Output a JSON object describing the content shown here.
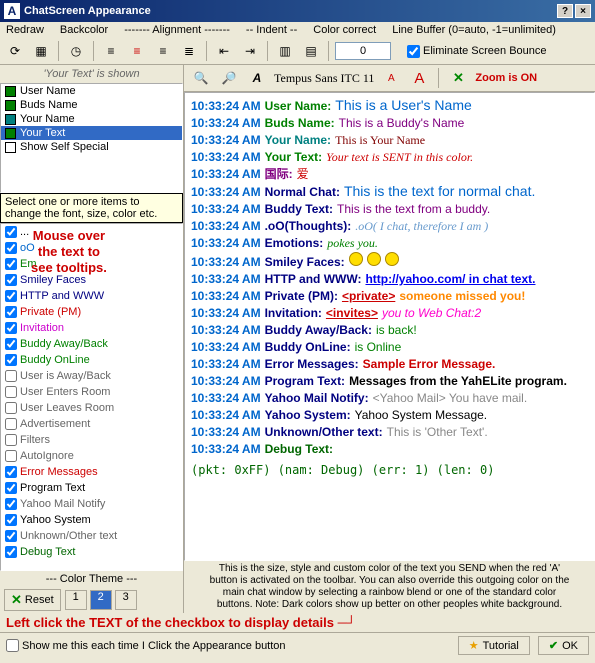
{
  "title": "ChatScreen Appearance",
  "menubar": {
    "redraw": "Redraw",
    "backcolor": "Backcolor",
    "alignment": "------- Alignment -------",
    "indent": "-- Indent --",
    "colorcorrect": "Color correct",
    "linebuf": "Line Buffer (0=auto, -1=unlimited)"
  },
  "linebuf_value": "0",
  "eliminate_bounce": "Eliminate Screen Bounce",
  "list_header": "'Your Text' is shown",
  "upper_list": [
    {
      "label": "User Name",
      "color": "#008000"
    },
    {
      "label": "Buds Name",
      "color": "#008000"
    },
    {
      "label": "Your Name",
      "color": "#008080"
    },
    {
      "label": "Your Text",
      "color": "#008000",
      "selected": true
    },
    {
      "label": "Show Self Special",
      "color": "#ffffff"
    }
  ],
  "tooltip": "Select one or more items to change the font, size, color etc.",
  "overlay": [
    "Mouse over",
    "the text to",
    "see tooltips."
  ],
  "check_list": [
    {
      "label": "...",
      "checked": true,
      "color": "#000"
    },
    {
      "label": "oO",
      "checked": true,
      "color": "#0066cc"
    },
    {
      "label": "Em",
      "checked": true,
      "color": "#008000"
    },
    {
      "label": "Smiley Faces",
      "checked": true,
      "color": "#000080"
    },
    {
      "label": "HTTP and WWW",
      "checked": true,
      "color": "#000080"
    },
    {
      "label": "Private (PM)",
      "checked": true,
      "color": "#cc0000"
    },
    {
      "label": "Invitation",
      "checked": true,
      "color": "#cc00cc"
    },
    {
      "label": "Buddy Away/Back",
      "checked": true,
      "color": "#008000"
    },
    {
      "label": "Buddy OnLine",
      "checked": true,
      "color": "#008000"
    },
    {
      "label": "User is Away/Back",
      "checked": false,
      "color": "#666"
    },
    {
      "label": "User Enters Room",
      "checked": false,
      "color": "#666"
    },
    {
      "label": "User Leaves Room",
      "checked": false,
      "color": "#666"
    },
    {
      "label": "Advertisement",
      "checked": false,
      "color": "#666"
    },
    {
      "label": "Filters",
      "checked": false,
      "color": "#666"
    },
    {
      "label": "AutoIgnore",
      "checked": false,
      "color": "#666"
    },
    {
      "label": "Error Messages",
      "checked": true,
      "color": "#cc0000"
    },
    {
      "label": "Program Text",
      "checked": true,
      "color": "#000"
    },
    {
      "label": "Yahoo Mail Notify",
      "checked": true,
      "color": "#666"
    },
    {
      "label": "Yahoo System",
      "checked": true,
      "color": "#000"
    },
    {
      "label": "Unknown/Other text",
      "checked": true,
      "color": "#666"
    },
    {
      "label": "Debug Text",
      "checked": true,
      "color": "#006600"
    }
  ],
  "font_tool": {
    "fontname": "Tempus Sans ITC 11",
    "zoom": "Zoom is ON"
  },
  "timestamp": "10:33:24 AM",
  "chat_lines": [
    {
      "label": "User Name:",
      "lcolor": "#008000",
      "text": "This is a User's Name",
      "tcolor": "#0066cc",
      "tsize": "14px"
    },
    {
      "label": "Buds Name:",
      "lcolor": "#008000",
      "text": "This is a Buddy's Name",
      "tcolor": "#800080"
    },
    {
      "label": "Your Name:",
      "lcolor": "#008080",
      "text": "This is Your Name",
      "tcolor": "#800000",
      "font": "cursive"
    },
    {
      "label": "Your Text:",
      "lcolor": "#008000",
      "text": "Your text is SENT in this color.",
      "tcolor": "#cc0000",
      "italic": true,
      "font": "cursive"
    },
    {
      "label": "国际:",
      "lcolor": "#800080",
      "text": "爱",
      "tcolor": "#cc0000"
    },
    {
      "label": "Normal Chat:",
      "lcolor": "#000080",
      "text": "This is the text for normal chat.",
      "tcolor": "#0066cc",
      "tsize": "14px"
    },
    {
      "label": "Buddy Text:",
      "lcolor": "#000080",
      "text": "This is the text from a buddy.",
      "tcolor": "#800080"
    },
    {
      "label": ".oO(Thoughts):",
      "lcolor": "#000080",
      "text": ".oO( I chat, therefore I am )",
      "tcolor": "#6699cc",
      "italic": true,
      "font": "cursive"
    },
    {
      "label": "Emotions:",
      "lcolor": "#000080",
      "text": "pokes you.",
      "tcolor": "#008000",
      "italic": true,
      "font": "cursive"
    },
    {
      "label": "Smiley Faces:",
      "lcolor": "#000080",
      "smiley": true
    },
    {
      "label": "HTTP and WWW:",
      "lcolor": "#000080",
      "text": "http://yahoo.com/ in chat text.",
      "tcolor": "#0000ee",
      "underline": true,
      "bold": true
    },
    {
      "label": "Private (PM):",
      "lcolor": "#000080",
      "pre": "<private>",
      "precolor": "#cc0000",
      "text": "someone missed you!",
      "tcolor": "#ff8800",
      "bold": true
    },
    {
      "label": "Invitation:",
      "lcolor": "#000080",
      "pre": "<invites>",
      "precolor": "#cc0000",
      "text": "you to Web Chat:2",
      "tcolor": "#ff00cc",
      "italic": true
    },
    {
      "label": "Buddy Away/Back:",
      "lcolor": "#000080",
      "text": "is back!",
      "tcolor": "#008000"
    },
    {
      "label": "Buddy OnLine:",
      "lcolor": "#000080",
      "text": "is Online",
      "tcolor": "#008000"
    },
    {
      "label": "Error Messages:",
      "lcolor": "#000080",
      "text": "Sample Error Message.",
      "tcolor": "#cc0000",
      "bold": true
    },
    {
      "label": "Program Text:",
      "lcolor": "#000080",
      "text": "Messages from the YahELite program.",
      "tcolor": "#000",
      "bold": true
    },
    {
      "label": "Yahoo Mail Notify:",
      "lcolor": "#000080",
      "text": "<Yahoo Mail> You have mail.",
      "tcolor": "#888"
    },
    {
      "label": "Yahoo System:",
      "lcolor": "#000080",
      "text": "Yahoo System Message.",
      "tcolor": "#000"
    },
    {
      "label": "Unknown/Other text:",
      "lcolor": "#000080",
      "text": "This is 'Other Text'.",
      "tcolor": "#888"
    },
    {
      "label": "Debug Text:",
      "lcolor": "#006600",
      "text": "(pkt: 0xFF) (nam: Debug) (err: 1) (len: 0)",
      "tcolor": "#006600",
      "mono": true,
      "nolabelblock": true
    }
  ],
  "bottom_hint": "This is the size, style and custom color of the text you SEND when the red 'A' button is activated on the toolbar. You can also override this outgoing color on the main chat window by selecting a rainbow blend or one of the standard color buttons. Note: Dark colors show up better on other peoples white background.",
  "theme_label": "--- Color Theme ---",
  "reset": "Reset",
  "theme_buttons": [
    "1",
    "2",
    "3"
  ],
  "theme_active": 1,
  "footer_hint": "Left click the TEXT of the checkbox to display details",
  "show_me": "Show me this each time I Click the Appearance button",
  "tutorial": "Tutorial",
  "ok": "OK"
}
